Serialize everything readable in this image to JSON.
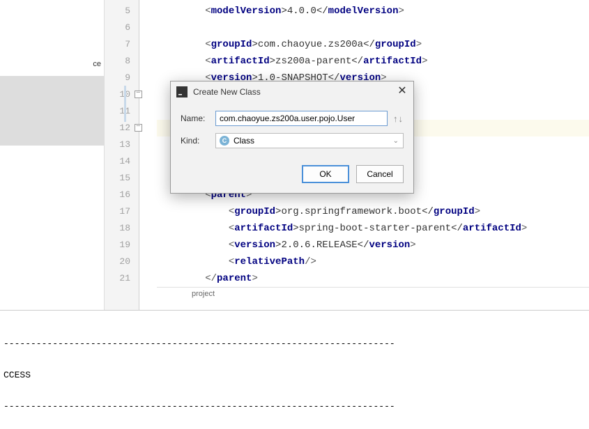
{
  "sidebar": {
    "item": "ce"
  },
  "gutter": {
    "lines": [
      "5",
      "6",
      "7",
      "8",
      "9",
      "10",
      "11",
      "12",
      "13",
      "14",
      "15",
      "16",
      "17",
      "18",
      "19",
      "20",
      "21"
    ]
  },
  "code": {
    "l5": {
      "ind": "        ",
      "o": "<",
      "t1": "modelVersion",
      "m": ">4.0.0</",
      "t2": "modelVersion",
      "c": ">"
    },
    "l6": "",
    "l7": {
      "ind": "        ",
      "o": "<",
      "t1": "groupId",
      "m": ">com.chaoyue.zs200a</",
      "t2": "groupId",
      "c": ">"
    },
    "l8": {
      "ind": "        ",
      "o": "<",
      "t1": "artifactId",
      "m": ">zs200a-parent</",
      "t2": "artifactId",
      "c": ">"
    },
    "l9": {
      "ind": "        ",
      "o": "<",
      "t1": "version",
      "m": ">1.0-SNAPSHOT</",
      "t2": "version",
      "c": ">"
    },
    "l10": "",
    "l11": "",
    "l12": "",
    "l13": "",
    "l14": "",
    "l15": "",
    "l16": {
      "ind": "        ",
      "o": "<",
      "t1": "parent",
      "c": ">"
    },
    "l17": {
      "ind": "            ",
      "o": "<",
      "t1": "groupId",
      "m": ">org.springframework.boot</",
      "t2": "groupId",
      "c": ">"
    },
    "l18": {
      "ind": "            ",
      "o": "<",
      "t1": "artifactId",
      "m": ">spring-boot-starter-parent</",
      "t2": "artifactId",
      "c": ">"
    },
    "l19": {
      "ind": "            ",
      "o": "<",
      "t1": "version",
      "m": ">2.0.6.RELEASE</",
      "t2": "version",
      "c": ">"
    },
    "l20": {
      "ind": "            ",
      "o": "<",
      "t1": "relativePath",
      "c": "/>"
    },
    "l21": {
      "ind": "        ",
      "o": "</",
      "t1": "parent",
      "c": ">"
    }
  },
  "breadcrumb": "project",
  "console": {
    "dash_top": "------------------------------------------------------------------------",
    "status": "CCESS",
    "dash_bottom": "------------------------------------------------------------------------"
  },
  "dialog": {
    "title": "Create New Class",
    "name_label": "Name:",
    "name_value": "com.chaoyue.zs200a.user.pojo.User",
    "arrows": "↑↓",
    "kind_label": "Kind:",
    "kind_icon_letter": "C",
    "kind_value": "Class",
    "ok": "OK",
    "cancel": "Cancel"
  }
}
